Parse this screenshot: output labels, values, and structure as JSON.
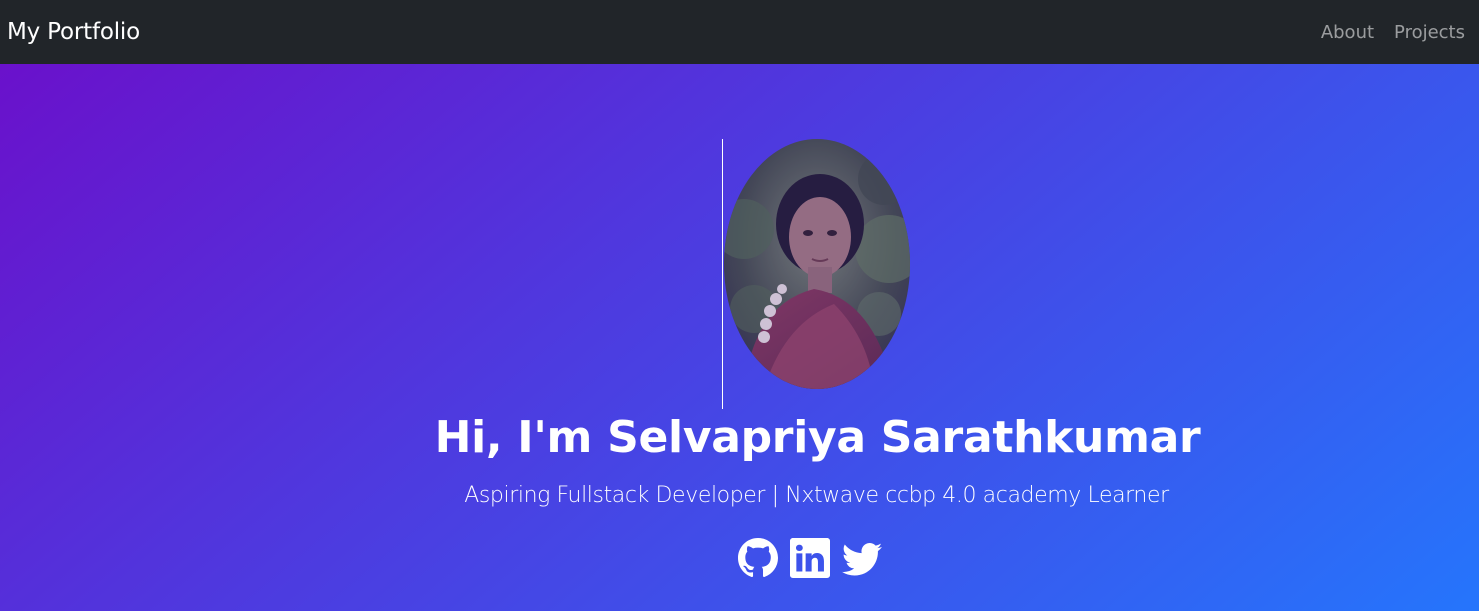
{
  "navbar": {
    "brand": "My Portfolio",
    "links": [
      {
        "label": "About"
      },
      {
        "label": "Projects"
      }
    ]
  },
  "hero": {
    "headline": "Hi, I'm Selvapriya Sarathkumar",
    "tagline": "Aspiring Fullstack Developer | Nxtwave ccbp 4.0 academy Learner",
    "gradient_start": "#6a11cb",
    "gradient_end": "#2575fc",
    "socials": [
      {
        "icon": "github-icon"
      },
      {
        "icon": "linkedin-icon"
      },
      {
        "icon": "twitter-icon"
      }
    ]
  },
  "colors": {
    "navbar_bg": "#212529",
    "text": "#ffffff",
    "nav_link": "#8f9295"
  }
}
